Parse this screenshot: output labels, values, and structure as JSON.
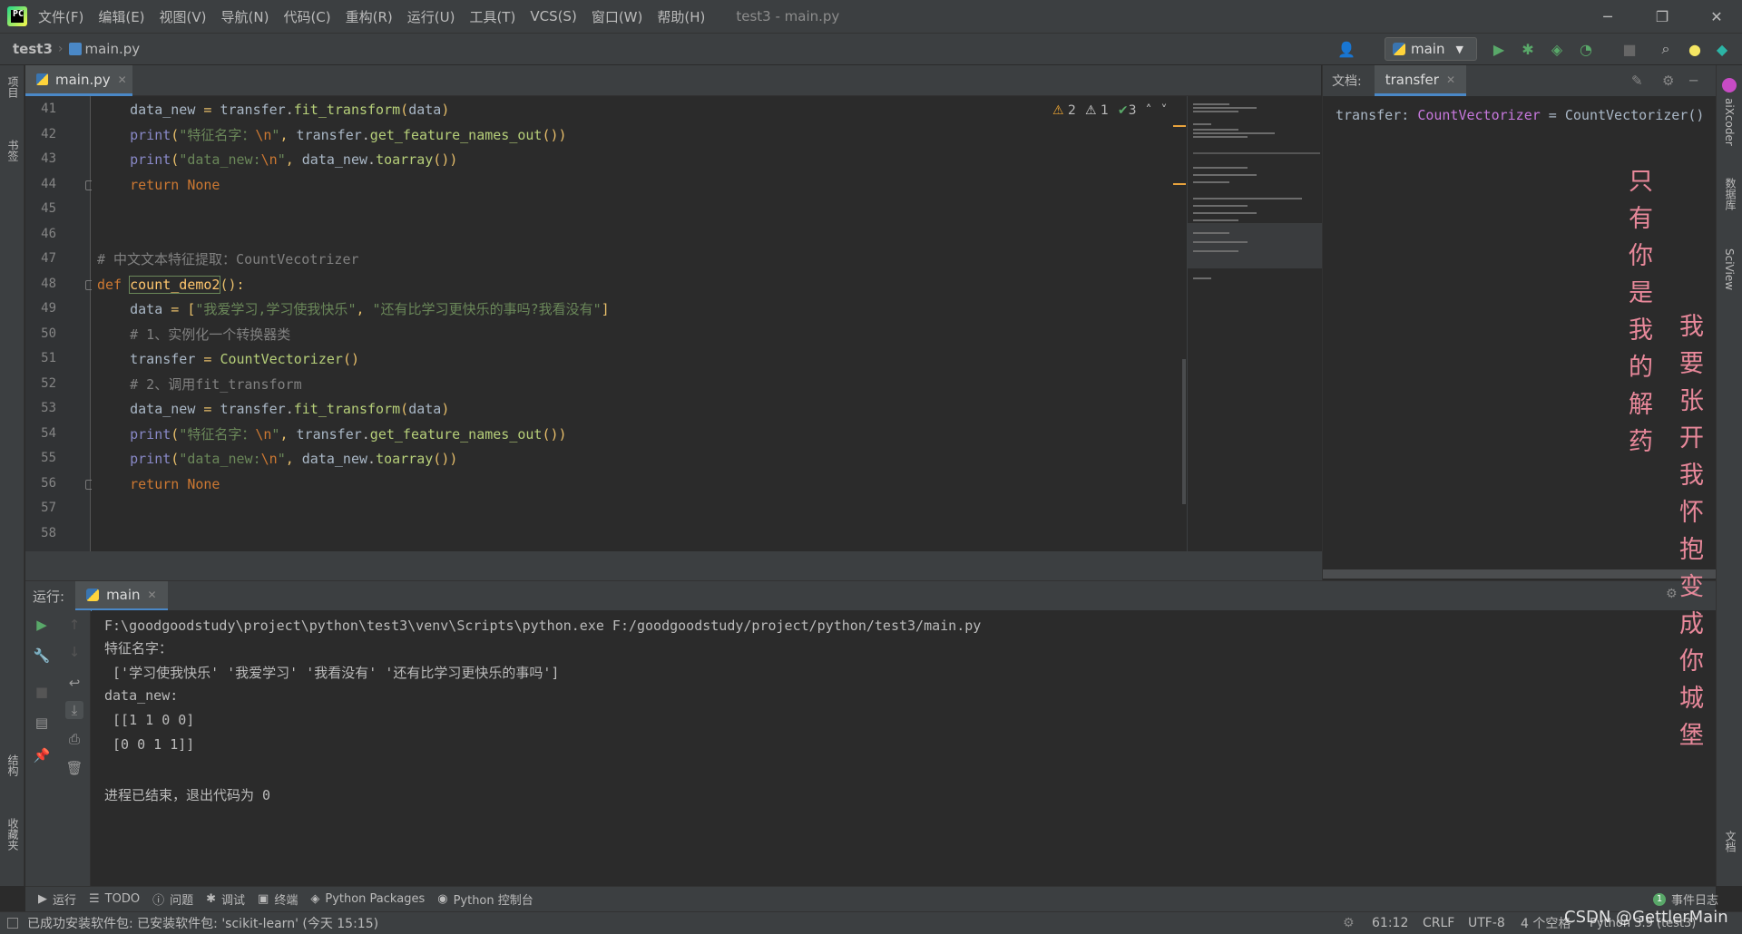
{
  "titlebar": {
    "menus": [
      "文件(F)",
      "编辑(E)",
      "视图(V)",
      "导航(N)",
      "代码(C)",
      "重构(R)",
      "运行(U)",
      "工具(T)",
      "VCS(S)",
      "窗口(W)",
      "帮助(H)"
    ],
    "window_title": "test3 - main.py"
  },
  "navbar": {
    "project": "test3",
    "file": "main.py",
    "run_config": "main"
  },
  "left_strip": {
    "project_label": "项目",
    "bookmarks_label": "书签",
    "structure_label": "结构",
    "favorites_label": "收藏夹"
  },
  "right_strip": {
    "aixcoder_label": "aiXcoder",
    "database_label": "数据库",
    "sciview_label": "SciView",
    "doc_label": "文档"
  },
  "editor": {
    "tab": "main.py",
    "inspections": {
      "warnings": "2",
      "weak_warnings": "1",
      "ok": "3"
    },
    "lines": [
      {
        "n": "41",
        "code": "    data_new = transfer.fit_transform(data)"
      },
      {
        "n": "42",
        "code": "    print(\"特征名字：\\n\", transfer.get_feature_names_out())"
      },
      {
        "n": "43",
        "code": "    print(\"data_new:\\n\", data_new.toarray())"
      },
      {
        "n": "44",
        "code": "    return None"
      },
      {
        "n": "45",
        "code": ""
      },
      {
        "n": "46",
        "code": ""
      },
      {
        "n": "47",
        "code": "# 中文文本特征提取：CountVecotrizer"
      },
      {
        "n": "48",
        "code": "def count_demo2():"
      },
      {
        "n": "49",
        "code": "    data = [\"我爱学习,学习使我快乐\", \"还有比学习更快乐的事吗?我看没有\"]"
      },
      {
        "n": "50",
        "code": "    # 1、实例化一个转换器类"
      },
      {
        "n": "51",
        "code": "    transfer = CountVectorizer()"
      },
      {
        "n": "52",
        "code": "    # 2、调用fit_transform"
      },
      {
        "n": "53",
        "code": "    data_new = transfer.fit_transform(data)"
      },
      {
        "n": "54",
        "code": "    print(\"特征名字：\\n\", transfer.get_feature_names_out())"
      },
      {
        "n": "55",
        "code": "    print(\"data_new:\\n\", data_new.toarray())"
      },
      {
        "n": "56",
        "code": "    return None"
      },
      {
        "n": "57",
        "code": ""
      },
      {
        "n": "58",
        "code": ""
      }
    ]
  },
  "doc": {
    "label": "文档:",
    "tab": "transfer",
    "text": "transfer: CountVectorizer = CountVectorizer()"
  },
  "run": {
    "label": "运行:",
    "tab": "main",
    "console": [
      "F:\\goodgoodstudy\\project\\python\\test3\\venv\\Scripts\\python.exe F:/goodgoodstudy/project/python/test3/main.py",
      "特征名字：",
      " ['学习使我快乐' '我爱学习' '我看没有' '还有比学习更快乐的事吗']",
      "data_new:",
      " [[1 1 0 0]",
      " [0 0 1 1]]",
      "",
      "进程已结束，退出代码为 0"
    ]
  },
  "bottom_tools": [
    "运行",
    "TODO",
    "问题",
    "调试",
    "终端",
    "Python Packages",
    "Python 控制台"
  ],
  "event_log": "事件日志",
  "status": {
    "message": "已成功安装软件包: 已安装软件包: 'scikit-learn' (今天 15:15)",
    "position": "61:12",
    "line_sep": "CRLF",
    "encoding": "UTF-8",
    "indent": "4 个空格",
    "interpreter": "Python 3.9 (test3)"
  },
  "overlay": {
    "poem_left": "只有你是我的解药",
    "poem_right": "我要张开我怀抱变成你城堡",
    "watermark": "CSDN @GettlerMain"
  },
  "colors": {
    "background": "#2b2b2b",
    "panel": "#3c3f41",
    "keyword": "#cc7832",
    "string": "#6a8759",
    "comment": "#808080",
    "function": "#ffc66d",
    "accent": "#4a88c7",
    "poem": "#e8889a"
  }
}
